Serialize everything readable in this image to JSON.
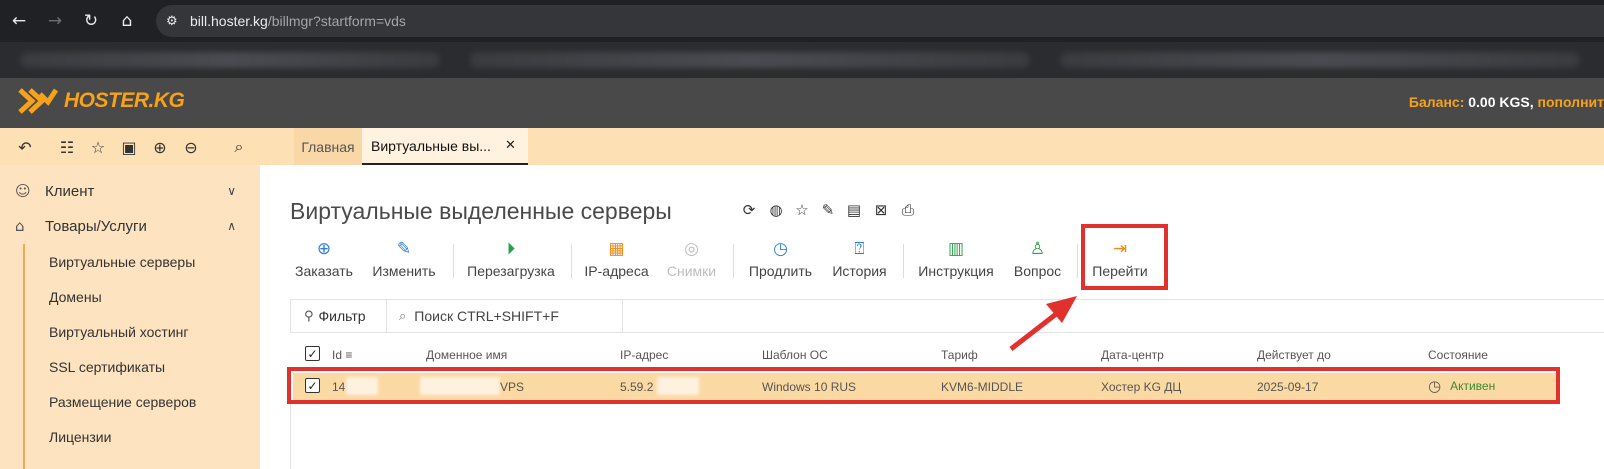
{
  "browser": {
    "url_host": "bill.hoster.kg",
    "url_path": "/billmgr?startform=vds"
  },
  "header": {
    "logo_text": "HOSTER.KG",
    "balance_label": "Баланс:",
    "balance_value": " 0.00 KGS,",
    "topup_link": " пополнит"
  },
  "tabs": [
    {
      "label": "Главная"
    },
    {
      "label": "Виртуальные вы..."
    }
  ],
  "sidebar": {
    "sections": [
      {
        "label": "Клиент",
        "expanded": false
      },
      {
        "label": "Товары/Услуги",
        "expanded": true
      }
    ],
    "items": [
      {
        "label": "Виртуальные серверы"
      },
      {
        "label": "Домены"
      },
      {
        "label": "Виртуальный хостинг"
      },
      {
        "label": "SSL сертификаты"
      },
      {
        "label": "Размещение серверов"
      },
      {
        "label": "Лицензии"
      }
    ]
  },
  "main": {
    "title": "Виртуальные выделенные серверы",
    "actions": [
      {
        "label": "Заказать",
        "icon": "plus-circle-icon",
        "color": "#2f7fd1",
        "enabled": true
      },
      {
        "label": "Изменить",
        "icon": "pencil-icon",
        "color": "#2f7fd1",
        "enabled": true
      },
      {
        "label": "Перезагрузка",
        "icon": "reboot-icon",
        "color": "#2aa14a",
        "enabled": true
      },
      {
        "label": "IP-адреса",
        "icon": "ip-icon",
        "color": "#f08a18",
        "enabled": true
      },
      {
        "label": "Снимки",
        "icon": "camera-icon",
        "color": "#bdbdbd",
        "enabled": false
      },
      {
        "label": "Продлить",
        "icon": "clock-icon",
        "color": "#2f7fd1",
        "enabled": true
      },
      {
        "label": "История",
        "icon": "history-icon",
        "color": "#2f7fd1",
        "enabled": true
      },
      {
        "label": "Инструкция",
        "icon": "manual-icon",
        "color": "#2aa14a",
        "enabled": true
      },
      {
        "label": "Вопрос",
        "icon": "question-user-icon",
        "color": "#2aa14a",
        "enabled": true
      },
      {
        "label": "Перейти",
        "icon": "go-to-icon",
        "color": "#f08a18",
        "enabled": true
      }
    ],
    "filter_label": "Фильтр",
    "search_placeholder": "Поиск CTRL+SHIFT+F"
  },
  "table": {
    "columns": [
      "Id",
      "Доменное имя",
      "IP-адрес",
      "Шаблон ОС",
      "Тариф",
      "Дата-центр",
      "Действует до",
      "Состояние"
    ],
    "rows": [
      {
        "id": "14",
        "domain": "VPS",
        "ip": "5.59.2",
        "os": "Windows 10 RUS",
        "tariff": "KVM6-MIDDLE",
        "datacenter": "Хостер KG ДЦ",
        "expires": "2025-09-17",
        "status": "Активен"
      }
    ]
  }
}
